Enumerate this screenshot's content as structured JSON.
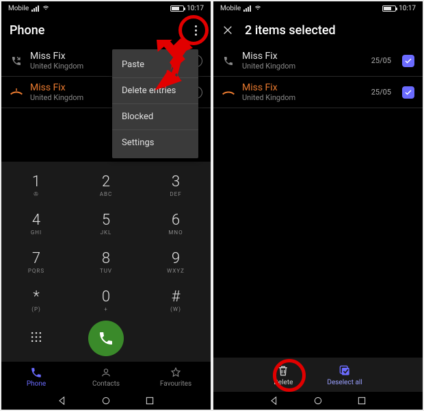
{
  "status": {
    "carrier": "Mobile",
    "time": "10:17"
  },
  "phone1": {
    "title": "Phone",
    "calls": [
      {
        "name": "Miss Fix",
        "sub": "United Kingdom",
        "missed": false
      },
      {
        "name": "Miss Fix",
        "sub": "United Kingdom",
        "missed": true
      }
    ],
    "menu": [
      "Paste",
      "Delete entries",
      "Blocked",
      "Settings"
    ],
    "keys": [
      {
        "big": "1",
        "small": "✇"
      },
      {
        "big": "2",
        "small": "ABC"
      },
      {
        "big": "3",
        "small": "DEF"
      },
      {
        "big": "4",
        "small": "GHI"
      },
      {
        "big": "5",
        "small": "JKL"
      },
      {
        "big": "6",
        "small": "MNO"
      },
      {
        "big": "7",
        "small": "PQRS"
      },
      {
        "big": "8",
        "small": "TUV"
      },
      {
        "big": "9",
        "small": "WXYZ"
      },
      {
        "big": "*",
        "small": "(P)"
      },
      {
        "big": "0",
        "small": "+"
      },
      {
        "big": "#",
        "small": "(W)"
      }
    ],
    "tabs": {
      "phone": "Phone",
      "contacts": "Contacts",
      "favourites": "Favourites"
    }
  },
  "phone2": {
    "title": "2 items selected",
    "calls": [
      {
        "name": "Miss Fix",
        "sub": "United Kingdom",
        "date": "25/05",
        "missed": false
      },
      {
        "name": "Miss Fix",
        "sub": "United Kingdom",
        "date": "25/05",
        "missed": true
      }
    ],
    "actions": {
      "delete": "Delete",
      "deselect": "Deselect all"
    }
  }
}
